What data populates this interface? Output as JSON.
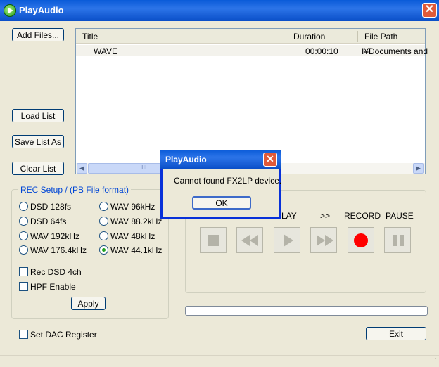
{
  "window": {
    "title": "PlayAudio",
    "close": "✕"
  },
  "buttons": {
    "add_files": "Add Files...",
    "load_list": "Load List",
    "save_list_as": "Save List As",
    "clear_list": "Clear List",
    "apply": "Apply",
    "exit": "Exit"
  },
  "file_list": {
    "columns": [
      "Title",
      "Duration",
      "File Path"
    ],
    "rows": [
      {
        "title": "WAVE",
        "duration": "00:00:10",
        "path": "I¥Documents and"
      }
    ],
    "scroll_left": "◀",
    "scroll_right": "▶",
    "thumb_grip": "III"
  },
  "rec_setup": {
    "legend": "REC Setup / (PB File format)",
    "options": [
      "DSD 128fs",
      "WAV 96kHz",
      "DSD 64fs",
      "WAV 88.2kHz",
      "WAV 192kHz",
      "WAV 48kHz",
      "WAV 176.4kHz",
      "WAV 44.1kHz"
    ],
    "selected": "WAV 44.1kHz",
    "rec_dsd_4ch": "Rec DSD 4ch",
    "hpf_enable": "HPF Enable"
  },
  "transport": {
    "labels": {
      "play": "LAY",
      "ff": ">>",
      "record": "RECORD",
      "pause": "PAUSE"
    },
    "progress": 0
  },
  "set_dac_register": "Set DAC Register",
  "dialog": {
    "title": "PlayAudio",
    "close": "✕",
    "message": "Cannot found FX2LP device.",
    "ok": "OK"
  },
  "colors": {
    "titlebar": "#0a5bd8",
    "accent_legend": "#0046d5",
    "record": "#ff0000"
  }
}
